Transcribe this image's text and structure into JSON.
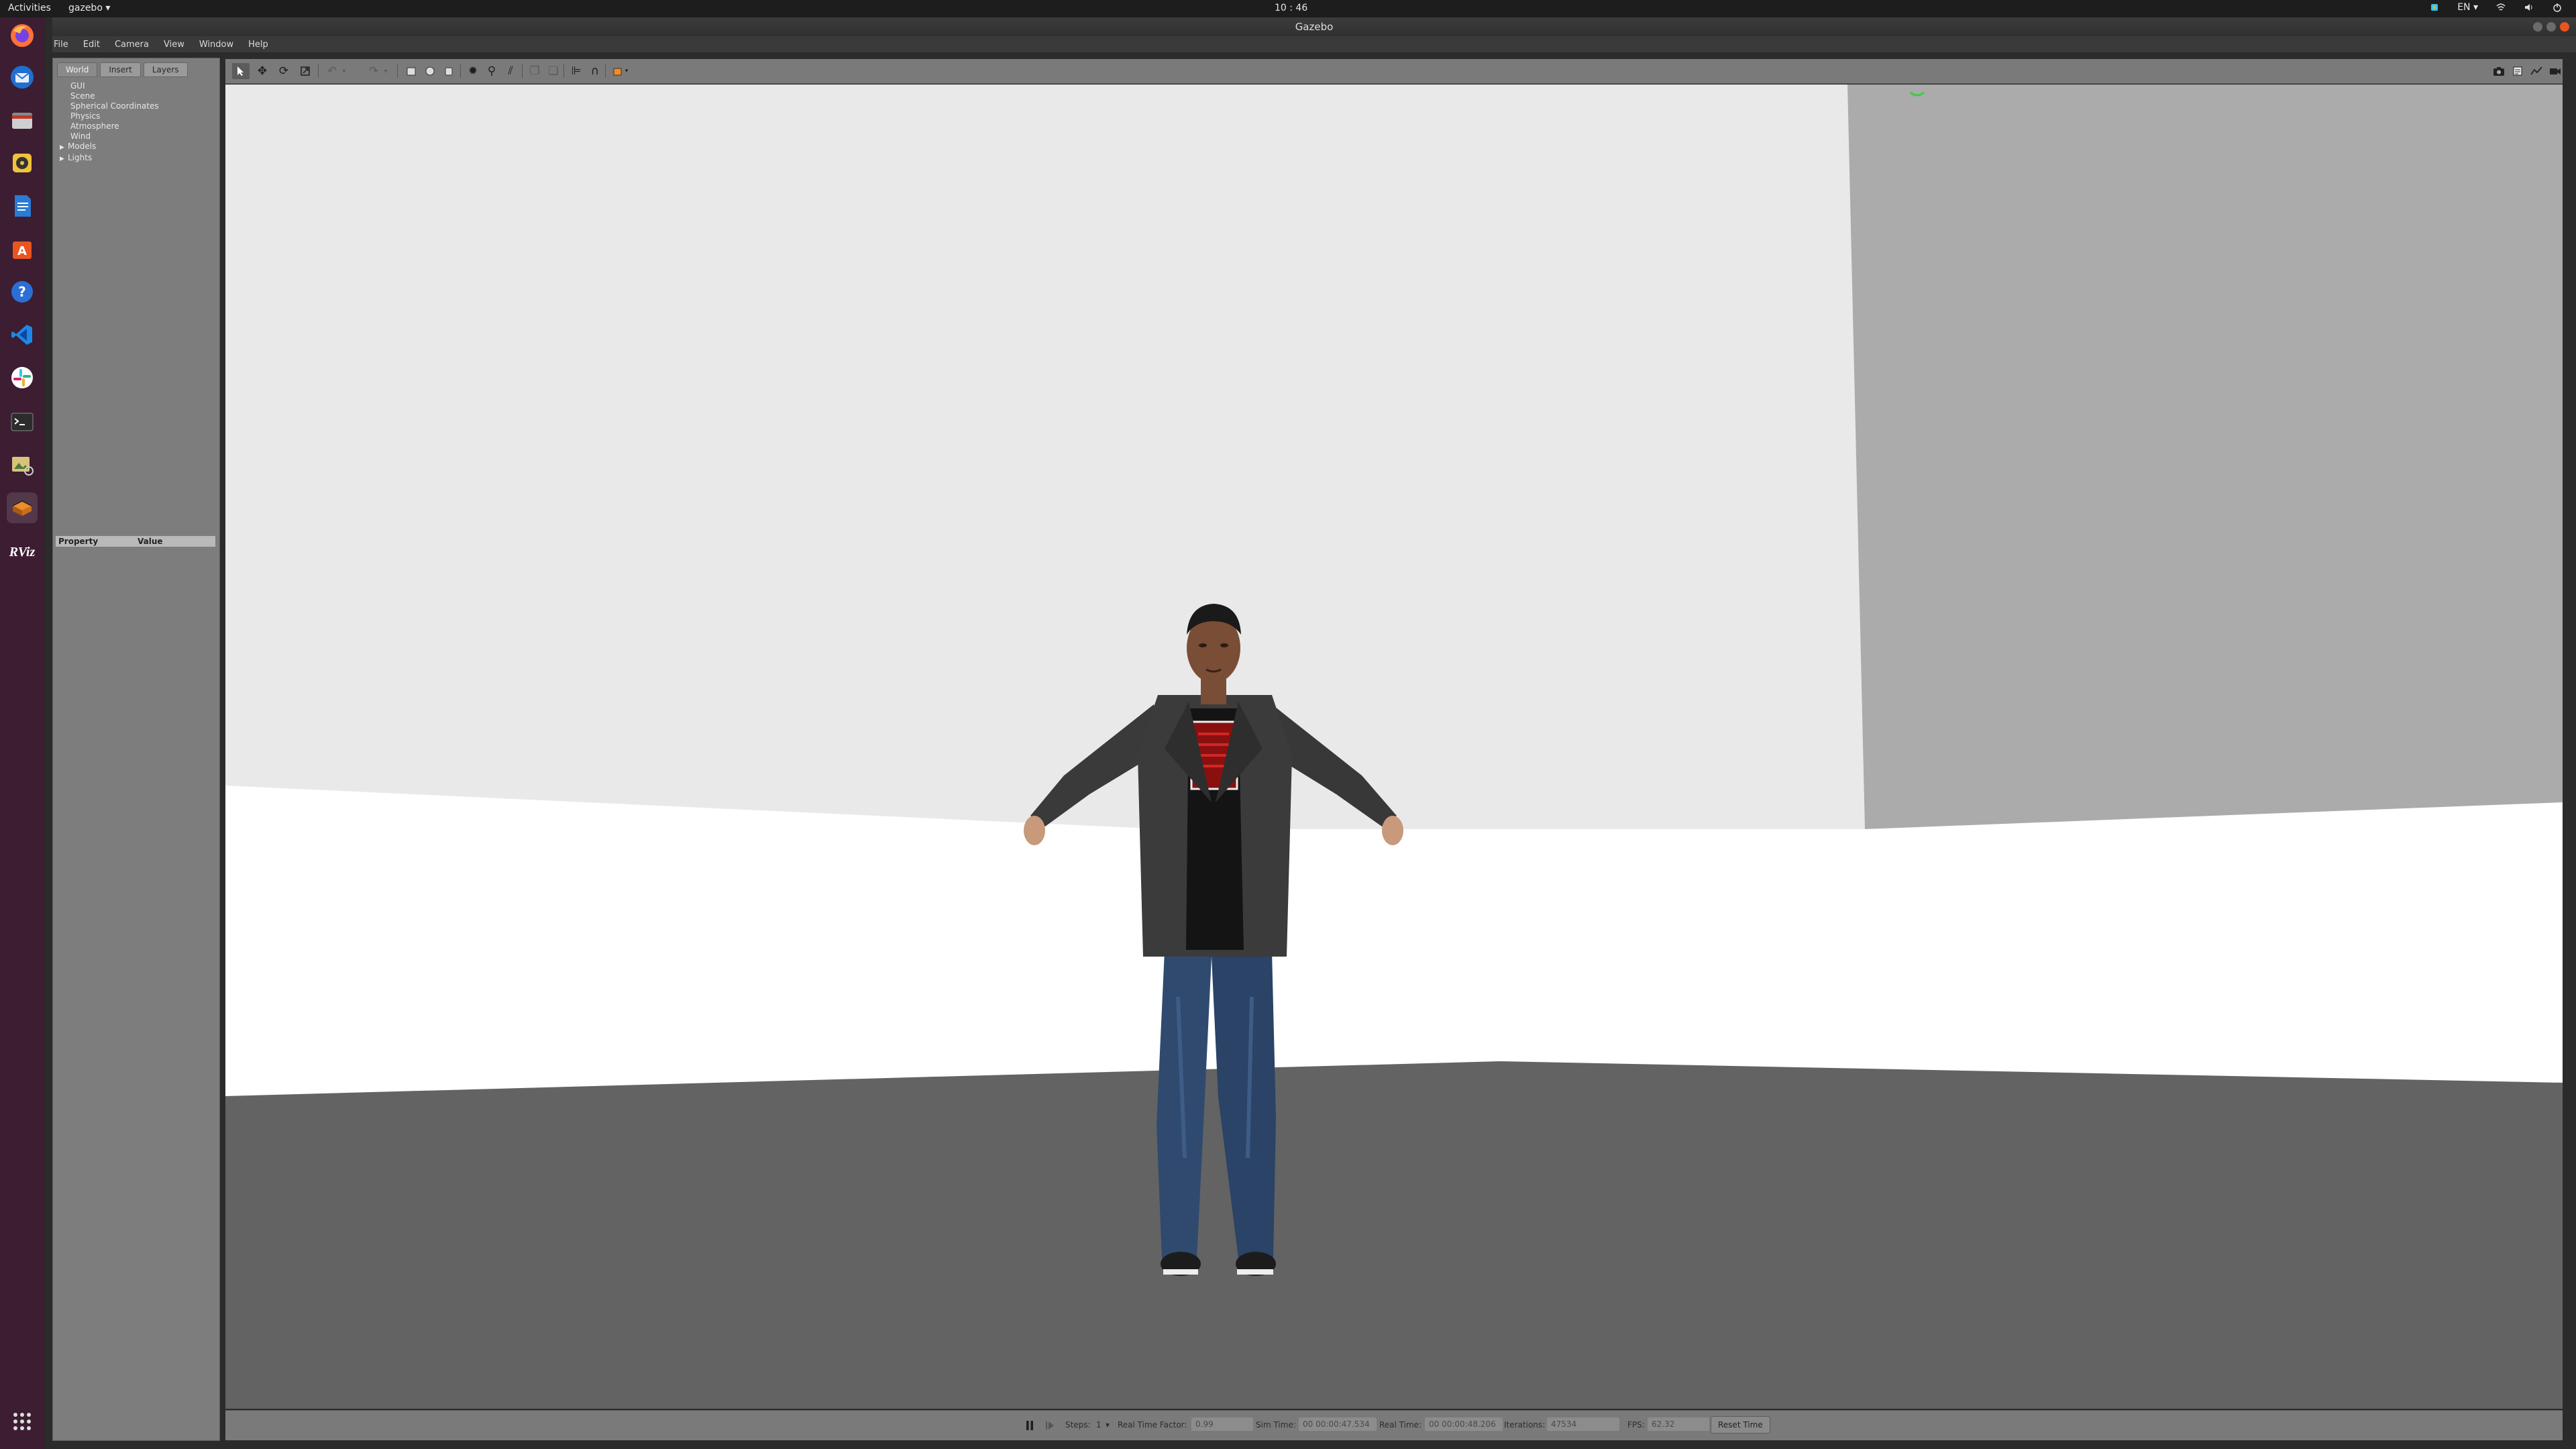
{
  "topbar": {
    "activities": "Activities",
    "app_menu": "gazebo ▾",
    "clock": "10 : 46",
    "lang": "EN ▾"
  },
  "window": {
    "title": "Gazebo"
  },
  "menubar": {
    "items": [
      "File",
      "Edit",
      "Camera",
      "View",
      "Window",
      "Help"
    ]
  },
  "left_panel": {
    "tabs": [
      "World",
      "Insert",
      "Layers"
    ],
    "selected_tab": "World",
    "tree": [
      "GUI",
      "Scene",
      "Spherical Coordinates",
      "Physics",
      "Atmosphere",
      "Wind",
      "Models",
      "Lights"
    ],
    "expandable": [
      "Models",
      "Lights"
    ],
    "property_header": {
      "property": "Property",
      "value": "Value"
    }
  },
  "dock": {
    "apps": [
      "firefox-icon",
      "thunderbird-icon",
      "files-icon",
      "rhythmbox-icon",
      "libreoffice-writer-icon",
      "ubuntu-software-icon",
      "help-icon",
      "vscode-icon",
      "slack-icon",
      "terminal-icon",
      "image-viewer-icon",
      "gazebo-icon",
      "rviz-icon"
    ],
    "rviz_label": "RViz"
  },
  "statusbar": {
    "steps_label": "Steps:",
    "steps_value": "1",
    "real_time_factor_label": "Real Time Factor:",
    "real_time_factor": "0.99",
    "sim_time_label": "Sim Time:",
    "sim_time": "00 00:00:47.534",
    "real_time_label": "Real Time:",
    "real_time": "00 00:00:48.206",
    "iterations_label": "Iterations:",
    "iterations": "47534",
    "fps_label": "FPS:",
    "fps": "62.32",
    "reset_time": "Reset Time"
  },
  "colors": {
    "ubuntu_orange": "#e95420",
    "dock_bg": "#3c1d32",
    "panel_bg": "#7d7d7d",
    "wall_light": "#e9e9e9",
    "wall_shadow": "#ababab",
    "floor_dark": "#636363"
  }
}
